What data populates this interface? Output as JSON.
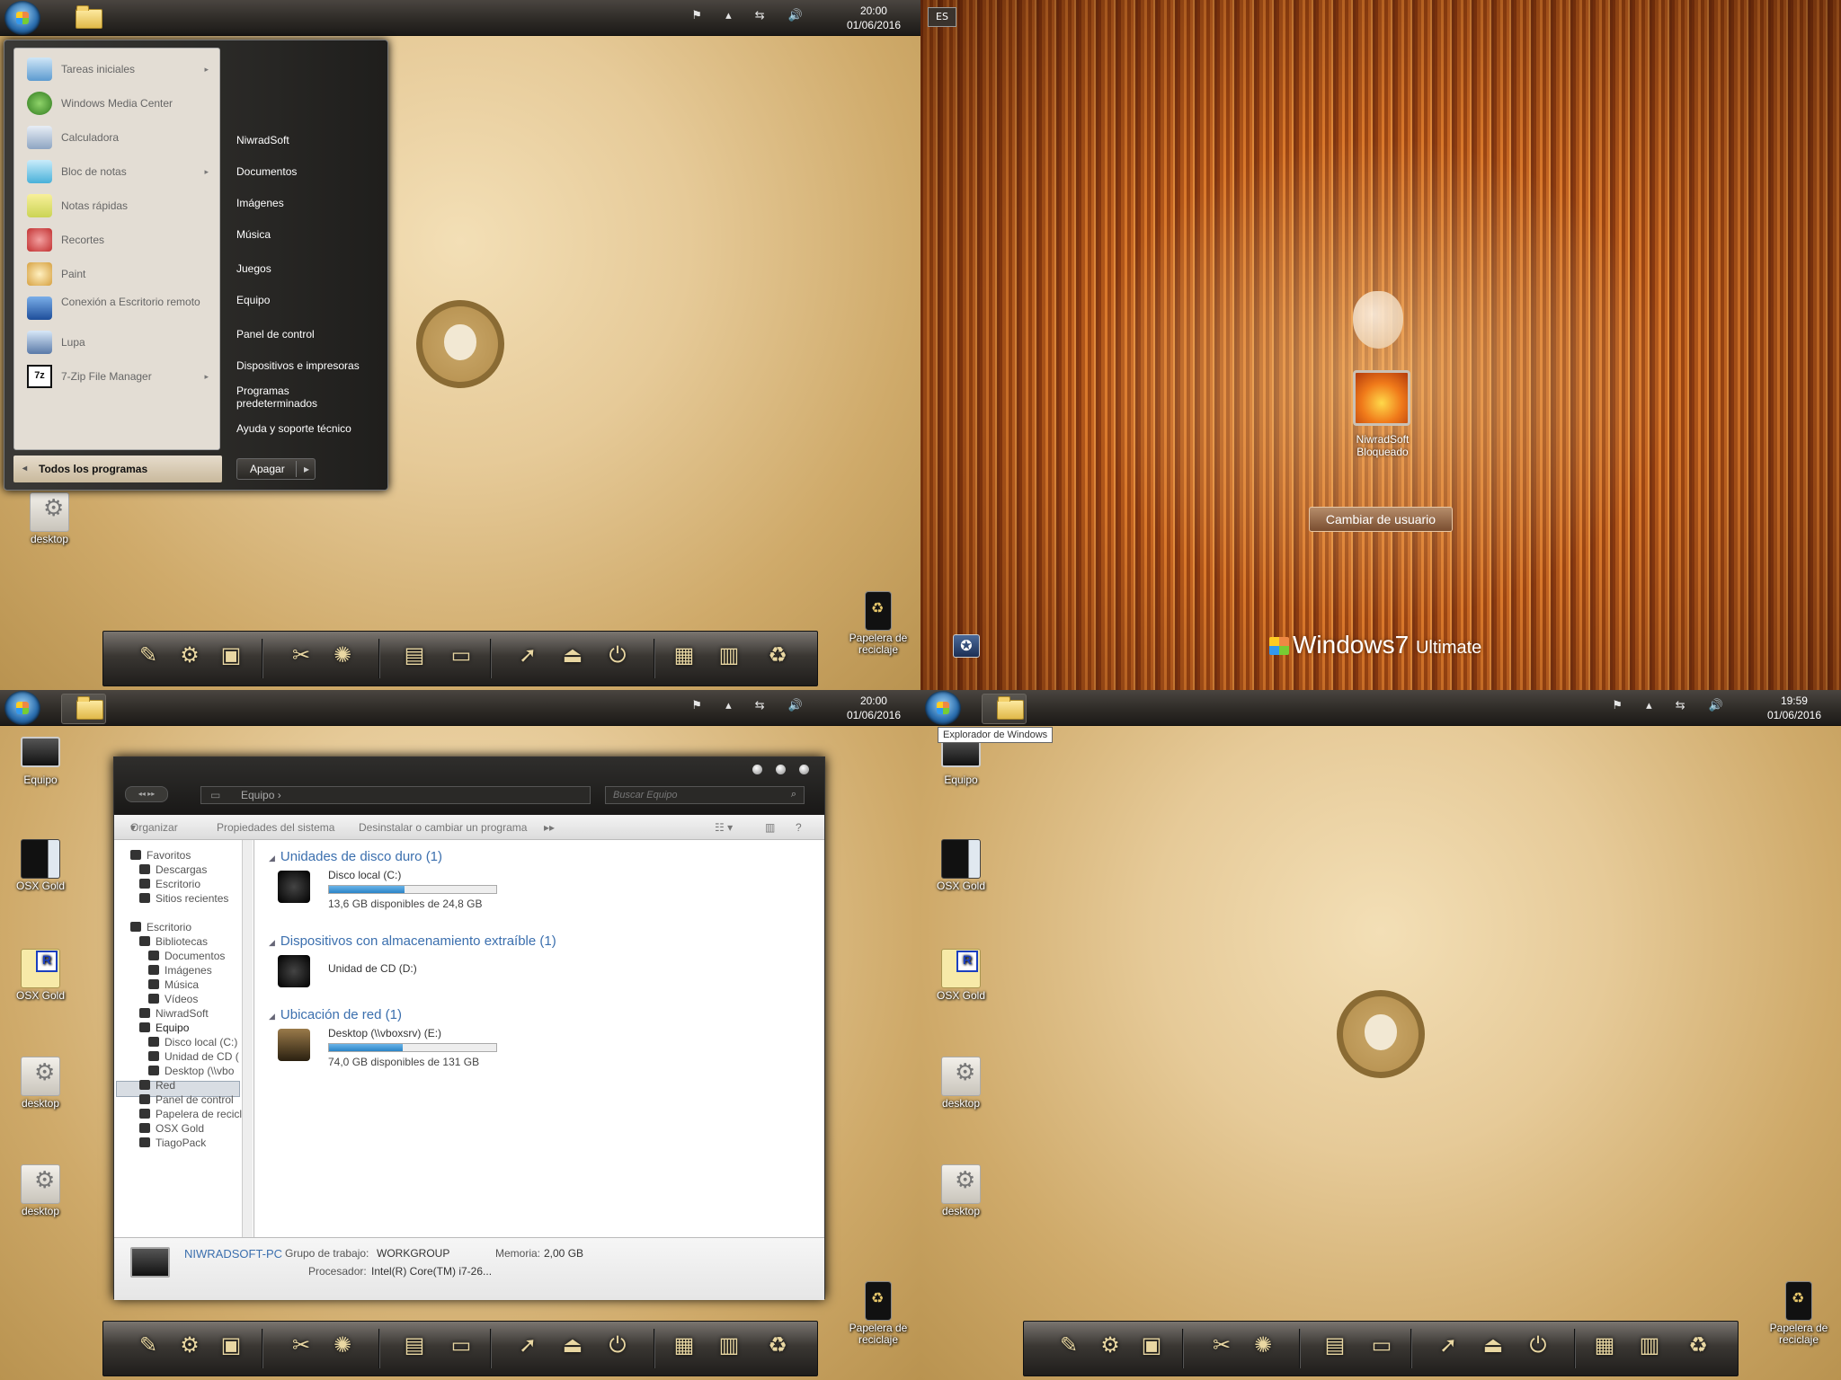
{
  "taskbar": {
    "clock_q1": {
      "time": "20:00",
      "date": "01/06/2016"
    },
    "clock_q3": {
      "time": "20:00",
      "date": "01/06/2016"
    },
    "clock_q4": {
      "time": "19:59",
      "date": "01/06/2016"
    },
    "tray_icons": [
      "flag-icon",
      "chevron-up-icon",
      "network-icon",
      "volume-icon"
    ]
  },
  "desktop_icons": {
    "desktop": "desktop",
    "equipo": "Equipo",
    "osx_gold": "OSX Gold",
    "recycle": "Papelera de reciclaje"
  },
  "start_menu": {
    "programs": [
      {
        "label": "Tareas iniciales",
        "icon": "getting-started-icon",
        "has_submenu": true
      },
      {
        "label": "Windows Media Center",
        "icon": "media-center-icon",
        "has_submenu": false
      },
      {
        "label": "Calculadora",
        "icon": "calculator-icon",
        "has_submenu": false
      },
      {
        "label": "Bloc de notas",
        "icon": "notepad-icon",
        "has_submenu": true
      },
      {
        "label": "Notas rápidas",
        "icon": "sticky-notes-icon",
        "has_submenu": false
      },
      {
        "label": "Recortes",
        "icon": "snipping-tool-icon",
        "has_submenu": false
      },
      {
        "label": "Paint",
        "icon": "paint-icon",
        "has_submenu": false
      },
      {
        "label": "Conexión a Escritorio remoto",
        "icon": "remote-desktop-icon",
        "has_submenu": false
      },
      {
        "label": "Lupa",
        "icon": "magnifier-icon",
        "has_submenu": false
      },
      {
        "label": "7-Zip File Manager",
        "icon": "7zip-icon",
        "has_submenu": true
      }
    ],
    "all_programs": "Todos los programas",
    "links": [
      "NiwradSoft",
      "Documentos",
      "Imágenes",
      "Música",
      "Juegos",
      "Equipo",
      "Panel de control",
      "Dispositivos e impresoras",
      "Programas predeterminados",
      "Ayuda y soporte técnico"
    ],
    "shutdown": "Apagar"
  },
  "logon": {
    "language": "ES",
    "user": "NiwradSoft",
    "status": "Bloqueado",
    "switch_user": "Cambiar de usuario",
    "brand_windows": "Windows",
    "brand_version": "7",
    "brand_edition": "Ultimate"
  },
  "explorer": {
    "address": "Equipo",
    "search_placeholder": "Buscar Equipo",
    "commands": [
      "Organizar",
      "Propiedades del sistema",
      "Desinstalar o cambiar un programa"
    ],
    "nav": [
      "Favoritos",
      "Descargas",
      "Escritorio",
      "Sitios recientes",
      "Escritorio",
      "Bibliotecas",
      "Documentos",
      "Imágenes",
      "Música",
      "Vídeos",
      "NiwradSoft",
      "Equipo",
      "Disco local (C:)",
      "Unidad de CD (",
      "Desktop (\\\\vbo",
      "Red",
      "Panel de control",
      "Papelera de recicl",
      "OSX Gold",
      "TiagoPack"
    ],
    "groups": [
      {
        "title": "Unidades de disco duro (1)"
      },
      {
        "title": "Dispositivos con almacenamiento extraíble (1)"
      },
      {
        "title": "Ubicación de red (1)"
      }
    ],
    "drives": [
      {
        "name": "Disco local (C:)",
        "free": "13,6 GB disponibles de 24,8 GB",
        "used_fraction": 0.45
      },
      {
        "name": "Unidad de CD (D:)"
      },
      {
        "name": "Desktop (\\\\vboxsrv) (E:)",
        "free": "74,0 GB disponibles de 131 GB",
        "used_fraction": 0.44
      }
    ],
    "details": {
      "pc_name": "NIWRADSOFT-PC",
      "workgroup_label": "Grupo de trabajo:",
      "workgroup": "WORKGROUP",
      "memory_label": "Memoria:",
      "memory": "2,00 GB",
      "processor_label": "Procesador:",
      "processor": "Intel(R) Core(TM) i7-26..."
    }
  },
  "tooltip": "Explorador de Windows",
  "dock_icons": [
    "documents-icon",
    "settings-gear-icon",
    "photo-icon",
    "tools-icon",
    "film-reel-icon",
    "drive-icon",
    "monitor-icon",
    "rocket-icon",
    "airplay-icon",
    "power-icon",
    "image-viewer-icon",
    "window-manager-icon",
    "recycle-icon"
  ]
}
